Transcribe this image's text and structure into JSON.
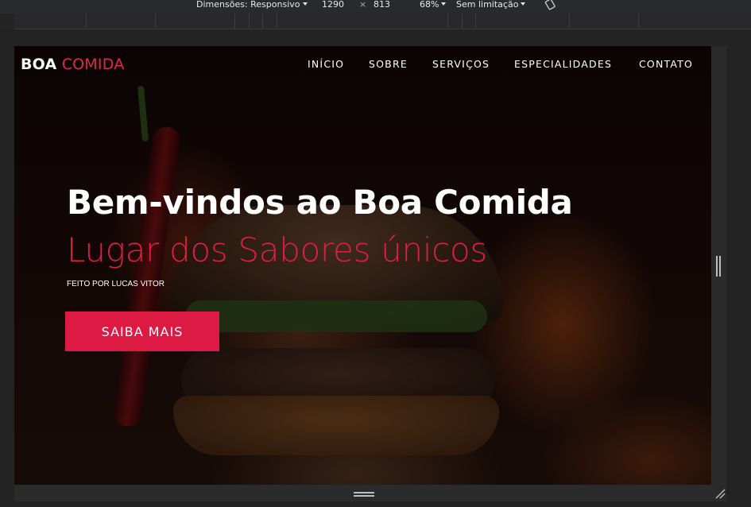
{
  "devtools": {
    "dimensions_label": "Dimensões: Responsivo",
    "width": "1290",
    "times": "×",
    "height": "813",
    "zoom": "68%",
    "throttle": "Sem limitação",
    "rotate_icon": "rotate-icon"
  },
  "site": {
    "logo_bold": "BOA",
    "logo_accent": "COMIDA",
    "nav": [
      {
        "label": "INÍCIO"
      },
      {
        "label": "SOBRE"
      },
      {
        "label": "SERVIÇOS"
      },
      {
        "label": "ESPECIALIDADES"
      },
      {
        "label": "CONTATO"
      }
    ],
    "hero": {
      "title": "Bem-vindos ao Boa Comida",
      "subtitle": "Lugar dos Sabores únicos",
      "credit": "FEITO POR LUCAS VITOR",
      "cta": "SAIBA MAIS"
    }
  },
  "colors": {
    "accent": "#dc1a44",
    "toolbar_bg": "#292a2d"
  }
}
